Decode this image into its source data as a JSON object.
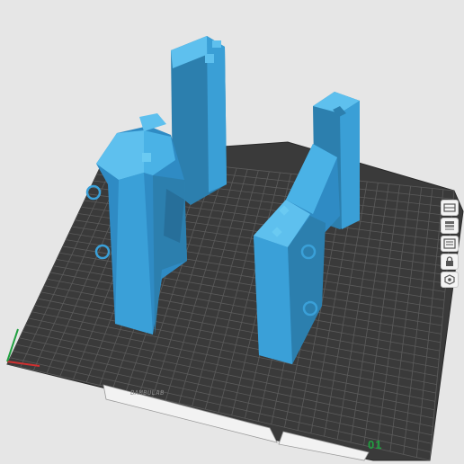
{
  "viewport": {
    "plate_id": "01",
    "plate_brand_text": "BAMBULAB",
    "colors": {
      "background": "#e6e6e6",
      "bed": "#3a3a3a",
      "grid": "#5a5a5a",
      "model": "#3aa0d8",
      "axis_x": "#d03030",
      "axis_y": "#20a040",
      "plate_id": "#20a040"
    }
  },
  "toolbar": {
    "items": [
      {
        "icon": "view-icon"
      },
      {
        "icon": "layers-icon"
      },
      {
        "icon": "objects-icon"
      },
      {
        "icon": "lock-icon"
      },
      {
        "icon": "settings-icon"
      }
    ]
  }
}
